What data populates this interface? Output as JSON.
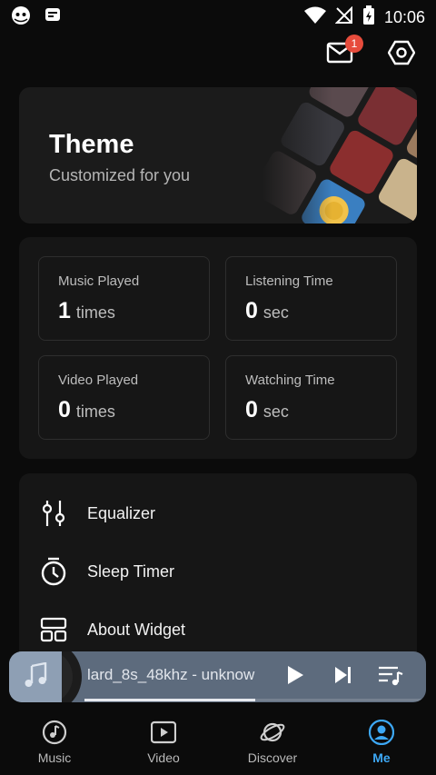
{
  "status_bar": {
    "time": "10:06",
    "icons": [
      "ghost-icon",
      "app-notification-icon",
      "wifi-icon",
      "no-signal-icon",
      "battery-charging-icon"
    ]
  },
  "header": {
    "mail_badge": "1",
    "icons": [
      "mail-icon",
      "settings-icon"
    ]
  },
  "theme_card": {
    "title": "Theme",
    "subtitle": "Customized for you"
  },
  "stats": [
    {
      "label": "Music Played",
      "value": "1",
      "unit": "times"
    },
    {
      "label": "Listening Time",
      "value": "0",
      "unit": "sec"
    },
    {
      "label": "Video Played",
      "value": "0",
      "unit": "times"
    },
    {
      "label": "Watching Time",
      "value": "0",
      "unit": "sec"
    }
  ],
  "menu": [
    {
      "label": "Equalizer",
      "icon": "equalizer-icon"
    },
    {
      "label": "Sleep Timer",
      "icon": "timer-icon"
    },
    {
      "label": "About Widget",
      "icon": "widget-icon"
    }
  ],
  "mini_player": {
    "title": "lard_8s_48khz - unknow",
    "progress_fraction": 0.5,
    "icons": [
      "music-note-icon",
      "play-icon",
      "skip-next-icon",
      "queue-icon"
    ]
  },
  "bottom_nav": {
    "items": [
      {
        "label": "Music",
        "icon": "music-disc-icon",
        "active": false
      },
      {
        "label": "Video",
        "icon": "video-icon",
        "active": false
      },
      {
        "label": "Discover",
        "icon": "planet-icon",
        "active": false
      },
      {
        "label": "Me",
        "icon": "person-icon",
        "active": true
      }
    ]
  },
  "colors": {
    "background": "#0b0b0b",
    "card": "#161616",
    "accent": "#3da8f5",
    "badge": "#e74c3c",
    "mini_player": "#5d6b7d"
  }
}
